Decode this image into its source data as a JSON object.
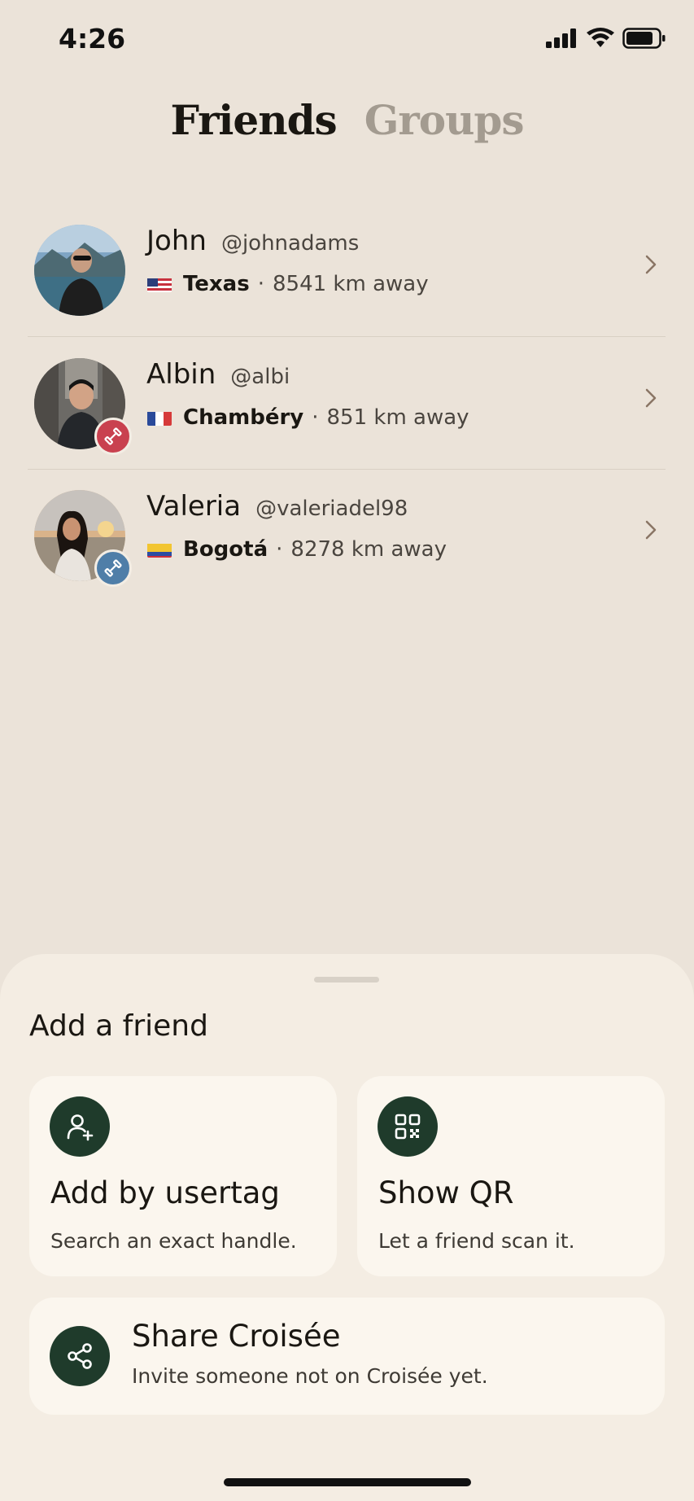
{
  "status_bar": {
    "time": "4:26"
  },
  "tabs": {
    "friends": "Friends",
    "groups": "Groups"
  },
  "friends": [
    {
      "name": "John",
      "handle": "@johnadams",
      "city": "Texas",
      "distance": "8541 km away",
      "flag": "US"
    },
    {
      "name": "Albin",
      "handle": "@albi",
      "city": "Chambéry",
      "distance": "851 km away",
      "flag": "FR",
      "badge_color": "#c9414f"
    },
    {
      "name": "Valeria",
      "handle": "@valeriadel98",
      "city": "Bogotá",
      "distance": "8278 km away",
      "flag": "CO",
      "badge_color": "#4f7ea8"
    }
  ],
  "separator": "·",
  "add_friend": {
    "title": "Add a friend",
    "usertag": {
      "title": "Add by usertag",
      "subtitle": "Search an exact handle."
    },
    "qr": {
      "title": "Show QR",
      "subtitle": "Let a friend scan it."
    },
    "share": {
      "title": "Share Croisée",
      "subtitle": "Invite someone not on Croisée yet."
    }
  },
  "colors": {
    "background": "#ebe3d9",
    "sheet": "#f4ede3",
    "card": "#fbf6ee",
    "icon_circle": "#1f3b2b",
    "inactive_tab": "#a39b90"
  }
}
